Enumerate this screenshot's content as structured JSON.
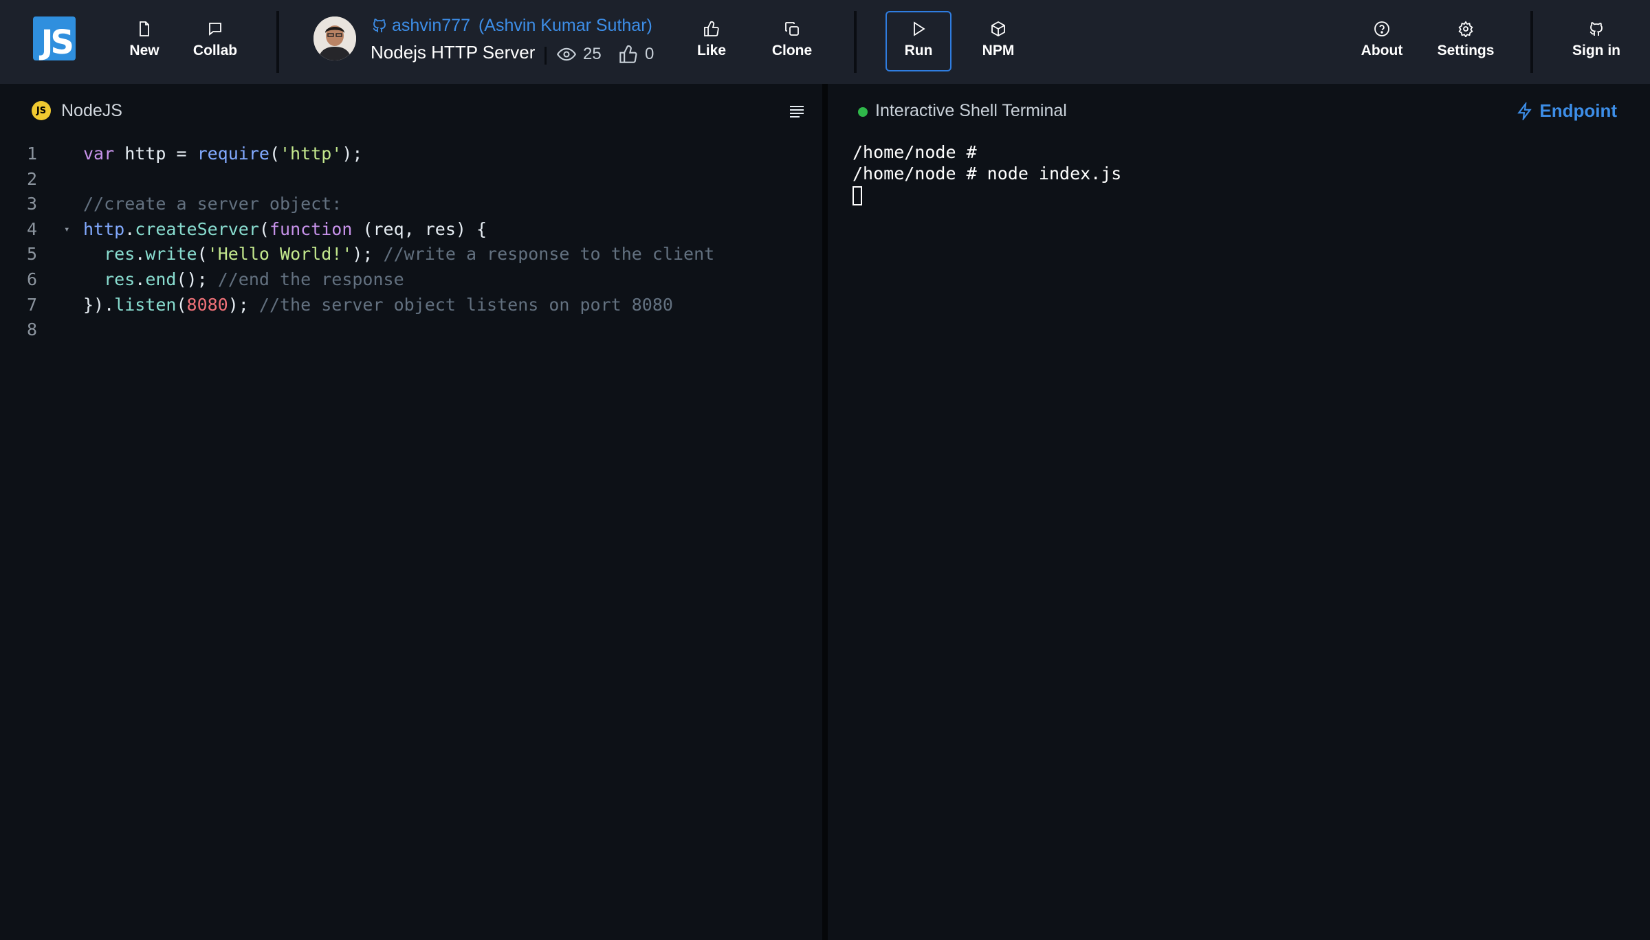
{
  "app": {
    "logo_text": "JS"
  },
  "toolbar": {
    "new_label": "New",
    "collab_label": "Collab",
    "like_label": "Like",
    "clone_label": "Clone",
    "run_label": "Run",
    "npm_label": "NPM",
    "about_label": "About",
    "settings_label": "Settings",
    "signin_label": "Sign in"
  },
  "project": {
    "owner_username": "ashvin777",
    "owner_fullname": "(Ashvin Kumar Suthar)",
    "title": "Nodejs HTTP Server",
    "views": "25",
    "likes": "0"
  },
  "editor": {
    "language_badge": "JS",
    "language": "NodeJS",
    "lines": [
      {
        "number": "1",
        "tokens": [
          {
            "t": "var",
            "c": "kw"
          },
          {
            "t": " http = ",
            "c": "plain"
          },
          {
            "t": "require",
            "c": "fn"
          },
          {
            "t": "(",
            "c": "plain"
          },
          {
            "t": "'http'",
            "c": "str"
          },
          {
            "t": ");",
            "c": "plain"
          }
        ]
      },
      {
        "number": "2",
        "tokens": []
      },
      {
        "number": "3",
        "tokens": [
          {
            "t": "//create a server object:",
            "c": "cm"
          }
        ]
      },
      {
        "number": "4",
        "fold": "▾",
        "tokens": [
          {
            "t": "http",
            "c": "fn"
          },
          {
            "t": ".",
            "c": "plain"
          },
          {
            "t": "createServer",
            "c": "mem"
          },
          {
            "t": "(",
            "c": "plain"
          },
          {
            "t": "function",
            "c": "kw"
          },
          {
            "t": " (req, res) {",
            "c": "plain"
          }
        ]
      },
      {
        "number": "5",
        "tokens": [
          {
            "t": "  res",
            "c": "mem"
          },
          {
            "t": ".",
            "c": "plain"
          },
          {
            "t": "write",
            "c": "mem"
          },
          {
            "t": "(",
            "c": "plain"
          },
          {
            "t": "'Hello World!'",
            "c": "str"
          },
          {
            "t": "); ",
            "c": "plain"
          },
          {
            "t": "//write a response to the client",
            "c": "cm"
          }
        ]
      },
      {
        "number": "6",
        "tokens": [
          {
            "t": "  res",
            "c": "mem"
          },
          {
            "t": ".",
            "c": "plain"
          },
          {
            "t": "end",
            "c": "mem"
          },
          {
            "t": "(); ",
            "c": "plain"
          },
          {
            "t": "//end the response",
            "c": "cm"
          }
        ]
      },
      {
        "number": "7",
        "tokens": [
          {
            "t": "}).",
            "c": "plain"
          },
          {
            "t": "listen",
            "c": "mem"
          },
          {
            "t": "(",
            "c": "plain"
          },
          {
            "t": "8080",
            "c": "num"
          },
          {
            "t": "); ",
            "c": "plain"
          },
          {
            "t": "//the server object listens on port 8080",
            "c": "cm"
          }
        ]
      },
      {
        "number": "8",
        "tokens": []
      }
    ]
  },
  "terminal": {
    "title": "Interactive Shell Terminal",
    "endpoint_label": "Endpoint",
    "status_color": "#2fb84a",
    "lines": [
      "/home/node #",
      "/home/node # node index.js"
    ]
  },
  "colors": {
    "accent": "#3d8ee8",
    "topbar_bg": "#1c212b",
    "editor_bg": "#0d1117",
    "logo_bg": "#2f8fde",
    "js_badge": "#f0c930"
  },
  "icons": {
    "new": "file-icon",
    "collab": "chat-icon",
    "owner": "github-icon",
    "views": "eye-icon",
    "likes": "thumbs-up-icon",
    "like": "thumbs-up-icon",
    "clone": "copy-icon",
    "run": "play-icon",
    "npm": "package-icon",
    "about": "help-circle-icon",
    "settings": "gear-icon",
    "signin": "github-icon",
    "menu": "menu-lines-icon",
    "endpoint": "lightning-icon"
  }
}
